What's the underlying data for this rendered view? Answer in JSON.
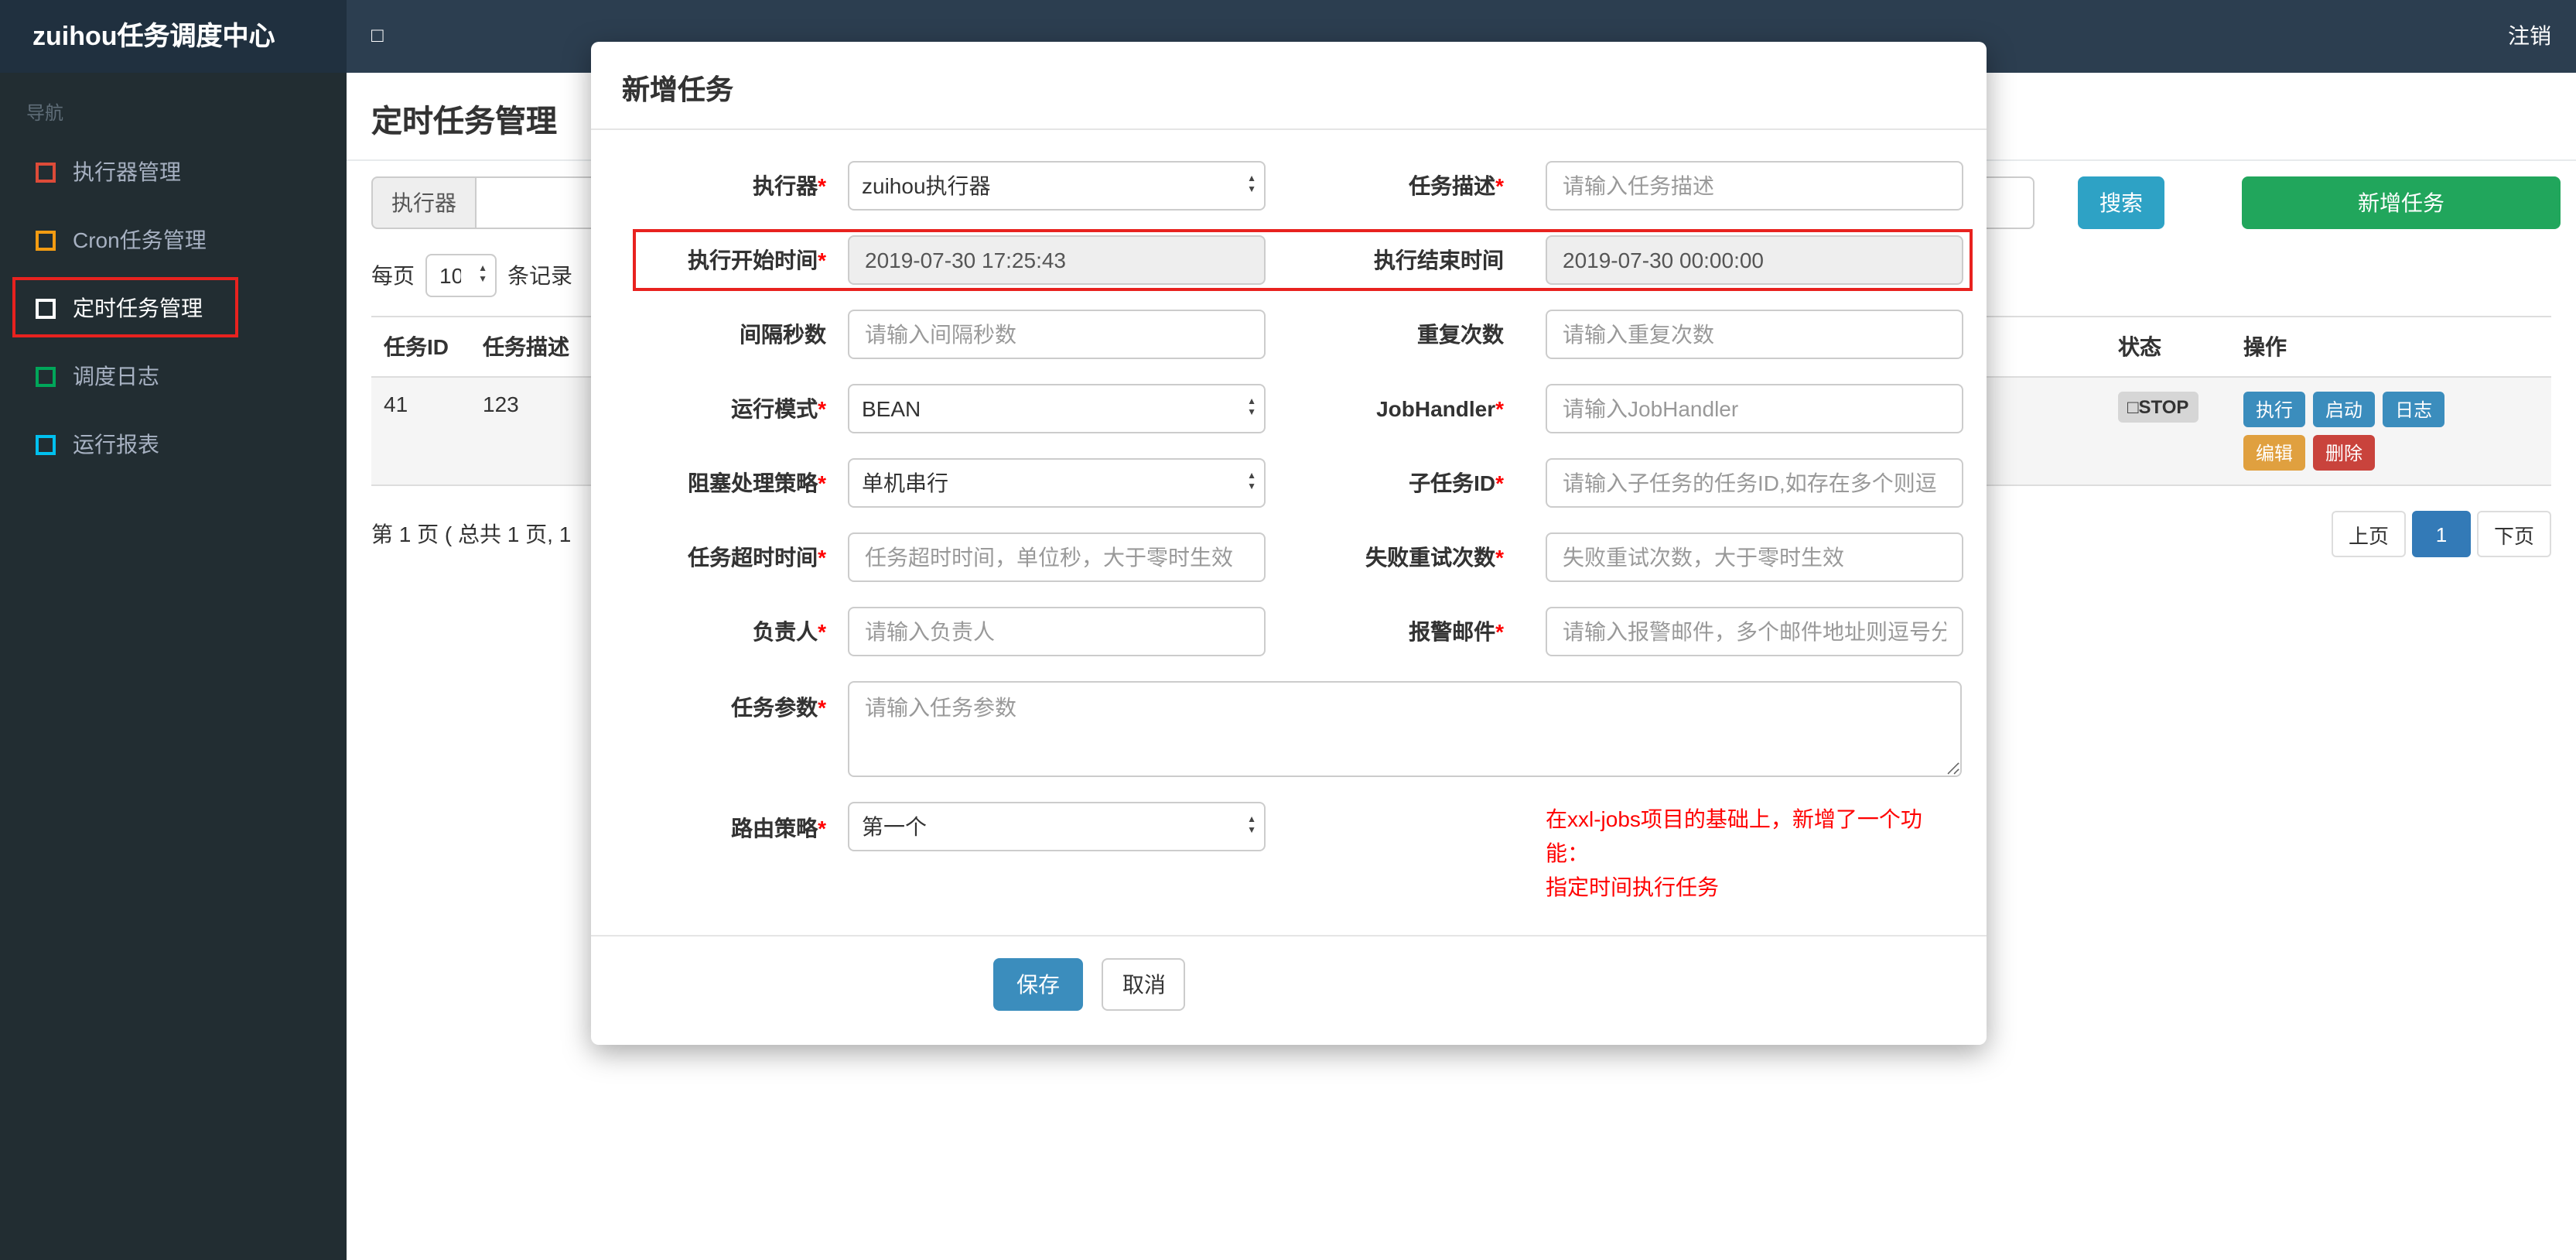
{
  "colors": {
    "topbar": "#2c3e50",
    "brand_bg": "#20303f",
    "sidebar": "#222d32",
    "search_button": "#2ea2c5",
    "add_button": "#21a65c",
    "primary_blue": "#3b8dbd",
    "edit_orange": "#e0a03f",
    "delete_red": "#c9433c",
    "annotation_red": "#e8221f",
    "note_red": "#ff0000",
    "active_page_blue": "#337ab7"
  },
  "topbar": {
    "brand": "zuihou任务调度中心",
    "toggle_icon": "□",
    "logout": "注销"
  },
  "sidebar": {
    "nav_label": "导航",
    "items": [
      {
        "label": "执行器管理",
        "icon": "square-outline-icon",
        "icon_css": "border-color:#dd4b39"
      },
      {
        "label": "Cron任务管理",
        "icon": "square-outline-icon",
        "icon_css": "border-color:#f39c12"
      },
      {
        "label": "定时任务管理",
        "icon": "square-outline-icon",
        "icon_css": "border-color:#ffffff",
        "active": true
      },
      {
        "label": "调度日志",
        "icon": "square-outline-icon",
        "icon_css": "border-color:#00a65a"
      },
      {
        "label": "运行报表",
        "icon": "square-outline-icon",
        "icon_css": "border-color:#00c0ef"
      }
    ]
  },
  "page": {
    "title": "定时任务管理",
    "filter": {
      "executor_label": "执行器",
      "search_button": "搜索",
      "add_button": "新增任务"
    },
    "per_page": {
      "prefix": "每页",
      "value": "10",
      "suffix": "条记录"
    },
    "table": {
      "headers": [
        "任务ID",
        "任务描述",
        "状态",
        "操作"
      ],
      "rows": [
        {
          "id": "41",
          "desc": "123",
          "status_icon": "□",
          "status": "STOP",
          "actions": [
            "执行",
            "启动",
            "日志",
            "编辑",
            "删除"
          ]
        }
      ]
    },
    "pagination": {
      "summary": "第 1 页 ( 总共 1 页, 1",
      "prev": "上页",
      "current": "1",
      "next": "下页"
    }
  },
  "modal": {
    "title": "新增任务",
    "fields": {
      "executor": {
        "label": "执行器",
        "star": "*",
        "value": "zuihou执行器"
      },
      "job_desc": {
        "label": "任务描述",
        "star": "*",
        "placeholder": "请输入任务描述"
      },
      "start_time": {
        "label": "执行开始时间",
        "star": "*",
        "value": "2019-07-30 17:25:43"
      },
      "end_time": {
        "label": "执行结束时间",
        "value": "2019-07-30 00:00:00"
      },
      "interval": {
        "label": "间隔秒数",
        "placeholder": "请输入间隔秒数"
      },
      "repeat": {
        "label": "重复次数",
        "placeholder": "请输入重复次数"
      },
      "run_mode": {
        "label": "运行模式",
        "star": "*",
        "value": "BEAN"
      },
      "job_handler": {
        "label": "JobHandler",
        "star": "*",
        "placeholder": "请输入JobHandler"
      },
      "block_strategy": {
        "label": "阻塞处理策略",
        "star": "*",
        "value": "单机串行"
      },
      "child_job_id": {
        "label": "子任务ID",
        "star": "*",
        "placeholder": "请输入子任务的任务ID,如存在多个则逗"
      },
      "timeout": {
        "label": "任务超时时间",
        "star": "*",
        "placeholder": "任务超时时间，单位秒，大于零时生效"
      },
      "fail_retry": {
        "label": "失败重试次数",
        "star": "*",
        "placeholder": "失败重试次数，大于零时生效"
      },
      "owner": {
        "label": "负责人",
        "star": "*",
        "placeholder": "请输入负责人"
      },
      "alarm_email": {
        "label": "报警邮件",
        "star": "*",
        "placeholder": "请输入报警邮件，多个邮件地址则逗号分"
      },
      "job_param": {
        "label": "任务参数",
        "star": "*",
        "placeholder": "请输入任务参数"
      },
      "route_strategy": {
        "label": "路由策略",
        "star": "*",
        "value": "第一个"
      }
    },
    "note_line1": "在xxl-jobs项目的基础上，新增了一个功能：",
    "note_line2": "指定时间执行任务",
    "save_button": "保存",
    "cancel_button": "取消"
  }
}
